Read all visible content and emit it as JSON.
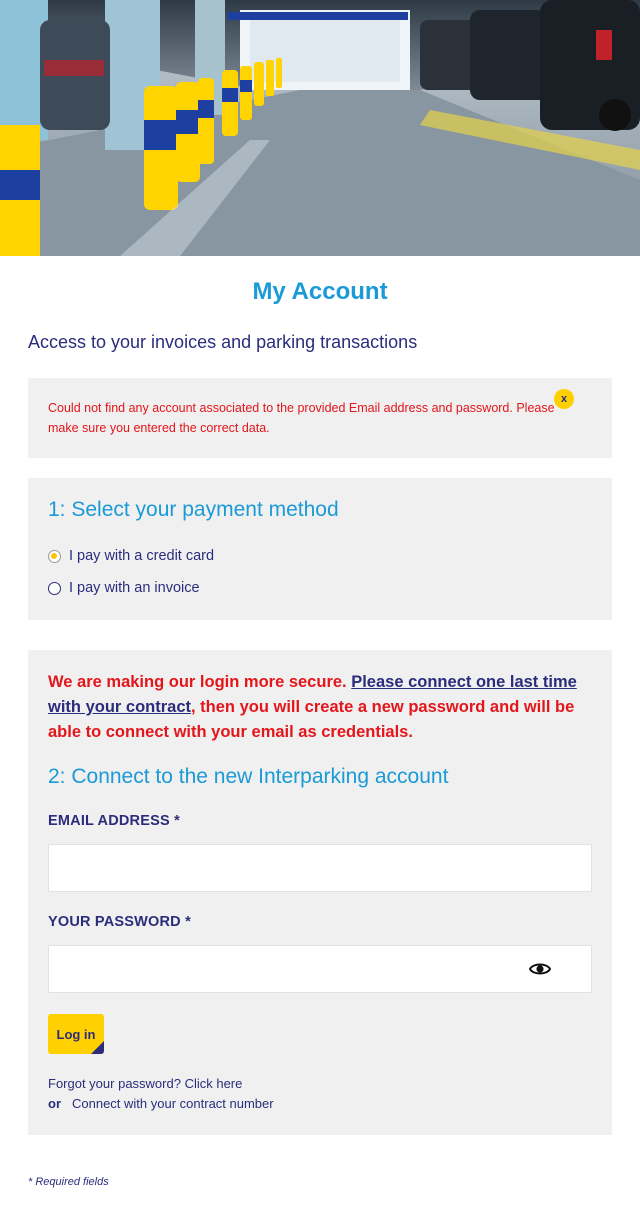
{
  "hero": {
    "image": "parking-garage-photo"
  },
  "page_title": "My Account",
  "subtitle": "Access to your invoices and parking transactions",
  "alert": {
    "message": "Could not find any account associated to the provided Email address and password. Please make sure you entered the correct data.",
    "close_label": "x"
  },
  "payment": {
    "title": "1: Select your payment method",
    "options": [
      {
        "label": "I pay with a credit card",
        "selected": true
      },
      {
        "label": "I pay with an invoice",
        "selected": false
      }
    ]
  },
  "login": {
    "notice_prefix": "We are making our login more secure. ",
    "notice_link": "Please connect one last time with your contract",
    "notice_suffix": ", then you will create a new password and will be able to connect with your email as credentials.",
    "title": "2: Connect to the new Interparking account",
    "email_label": "EMAIL ADDRESS *",
    "email_value": "",
    "password_label": "YOUR PASSWORD *",
    "password_value": "",
    "submit_label": "Log in",
    "forgot_link": "Forgot your password? Click here",
    "or_label": "or",
    "contract_link": "Connect with your contract number"
  },
  "required_note": "* Required fields",
  "colors": {
    "accent_blue": "#1a9ad6",
    "navy": "#2b2d7c",
    "error_red": "#e3161b",
    "brand_yellow": "#ffd000",
    "panel_gray": "#f0f0f0"
  }
}
